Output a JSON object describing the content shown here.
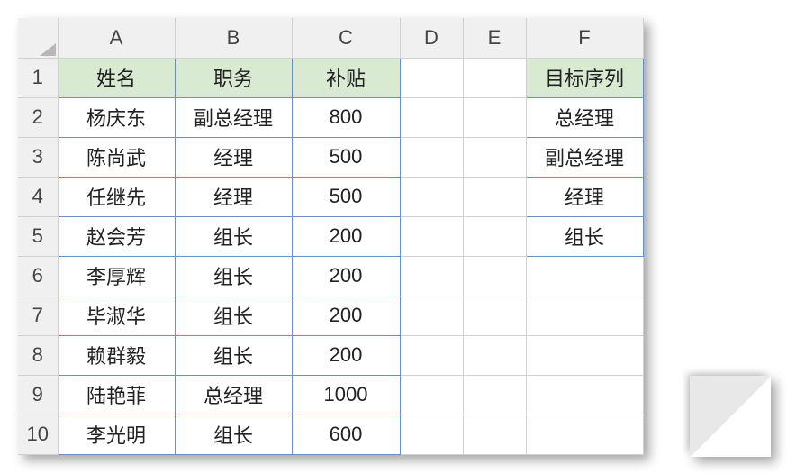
{
  "columns": [
    "A",
    "B",
    "C",
    "D",
    "E",
    "F"
  ],
  "rows": [
    "1",
    "2",
    "3",
    "4",
    "5",
    "6",
    "7",
    "8",
    "9",
    "10"
  ],
  "headers": {
    "A1": "姓名",
    "B1": "职务",
    "C1": "补贴",
    "F1": "目标序列"
  },
  "data": [
    {
      "name": "杨庆东",
      "role": "副总经理",
      "allowance": "800"
    },
    {
      "name": "陈尚武",
      "role": "经理",
      "allowance": "500"
    },
    {
      "name": "任继先",
      "role": "经理",
      "allowance": "500"
    },
    {
      "name": "赵会芳",
      "role": "组长",
      "allowance": "200"
    },
    {
      "name": "李厚辉",
      "role": "组长",
      "allowance": "200"
    },
    {
      "name": "毕淑华",
      "role": "组长",
      "allowance": "200"
    },
    {
      "name": "赖群毅",
      "role": "组长",
      "allowance": "200"
    },
    {
      "name": "陆艳菲",
      "role": "总经理",
      "allowance": "1000"
    },
    {
      "name": "李光明",
      "role": "组长",
      "allowance": "600"
    }
  ],
  "target_sequence": [
    "总经理",
    "副总经理",
    "经理",
    "组长"
  ],
  "chart_data": {
    "type": "table",
    "title": "",
    "columns": [
      "姓名",
      "职务",
      "补贴"
    ],
    "rows": [
      [
        "杨庆东",
        "副总经理",
        800
      ],
      [
        "陈尚武",
        "经理",
        500
      ],
      [
        "任继先",
        "经理",
        500
      ],
      [
        "赵会芳",
        "组长",
        200
      ],
      [
        "李厚辉",
        "组长",
        200
      ],
      [
        "毕淑华",
        "组长",
        200
      ],
      [
        "赖群毅",
        "组长",
        200
      ],
      [
        "陆艳菲",
        "总经理",
        1000
      ],
      [
        "李光明",
        "组长",
        600
      ]
    ],
    "aux_list": {
      "header": "目标序列",
      "values": [
        "总经理",
        "副总经理",
        "经理",
        "组长"
      ]
    }
  }
}
